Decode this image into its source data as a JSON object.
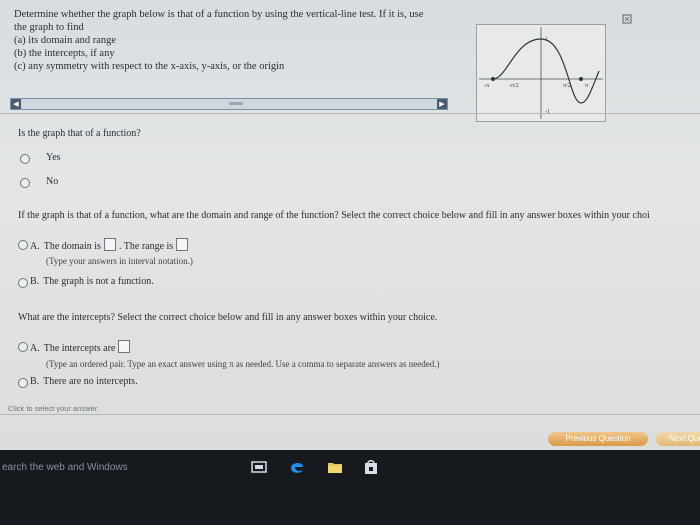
{
  "question": {
    "lines": [
      "Determine whether the graph below is that of a function by using the vertical-line test. If it is, use",
      "the graph to find",
      "(a) its domain and range",
      "(b) the intercepts, if any",
      "(c) any symmetry with respect to the x-axis, y-axis, or the origin"
    ]
  },
  "graph": {
    "ticks": {
      "x_neg_pi": "-π",
      "x_neg_half_pi": "-π/2",
      "x_half_pi": "π/2",
      "x_pi": "π",
      "y_one": "1",
      "y_neg_one": "-1"
    }
  },
  "part1": {
    "prompt": "Is the graph that of a function?",
    "options": [
      "Yes",
      "No"
    ]
  },
  "part2": {
    "prompt": "If the graph is that of a function, what are the domain and range of the function? Select the correct choice below and fill in any answer boxes within your choi",
    "choice_a_letter": "A.",
    "choice_a_text1": "The domain is",
    "choice_a_text2": ". The range is",
    "choice_a_hint": "(Type your answers in interval notation.)",
    "choice_b_letter": "B.",
    "choice_b_text": "The graph is not a function."
  },
  "part3": {
    "prompt": "What are the intercepts? Select the correct choice below and fill in any answer boxes within your choice.",
    "choice_a_letter": "A.",
    "choice_a_text": "The intercepts are",
    "choice_a_hint": "(Type an ordered pair. Type an exact answer using π as needed. Use a comma to separate answers as needed.)",
    "choice_b_letter": "B.",
    "choice_b_text": "There are no intercepts."
  },
  "footer": {
    "click_hint": "Click to select your answer.",
    "prev_button": "Previous Question",
    "next_button": "Next Que"
  },
  "taskbar": {
    "search_placeholder": "earch the web and Windows"
  },
  "colors": {
    "button_orange": "#d99a4a",
    "taskbar": "#161a1f",
    "edge_blue": "#1e90e8"
  }
}
